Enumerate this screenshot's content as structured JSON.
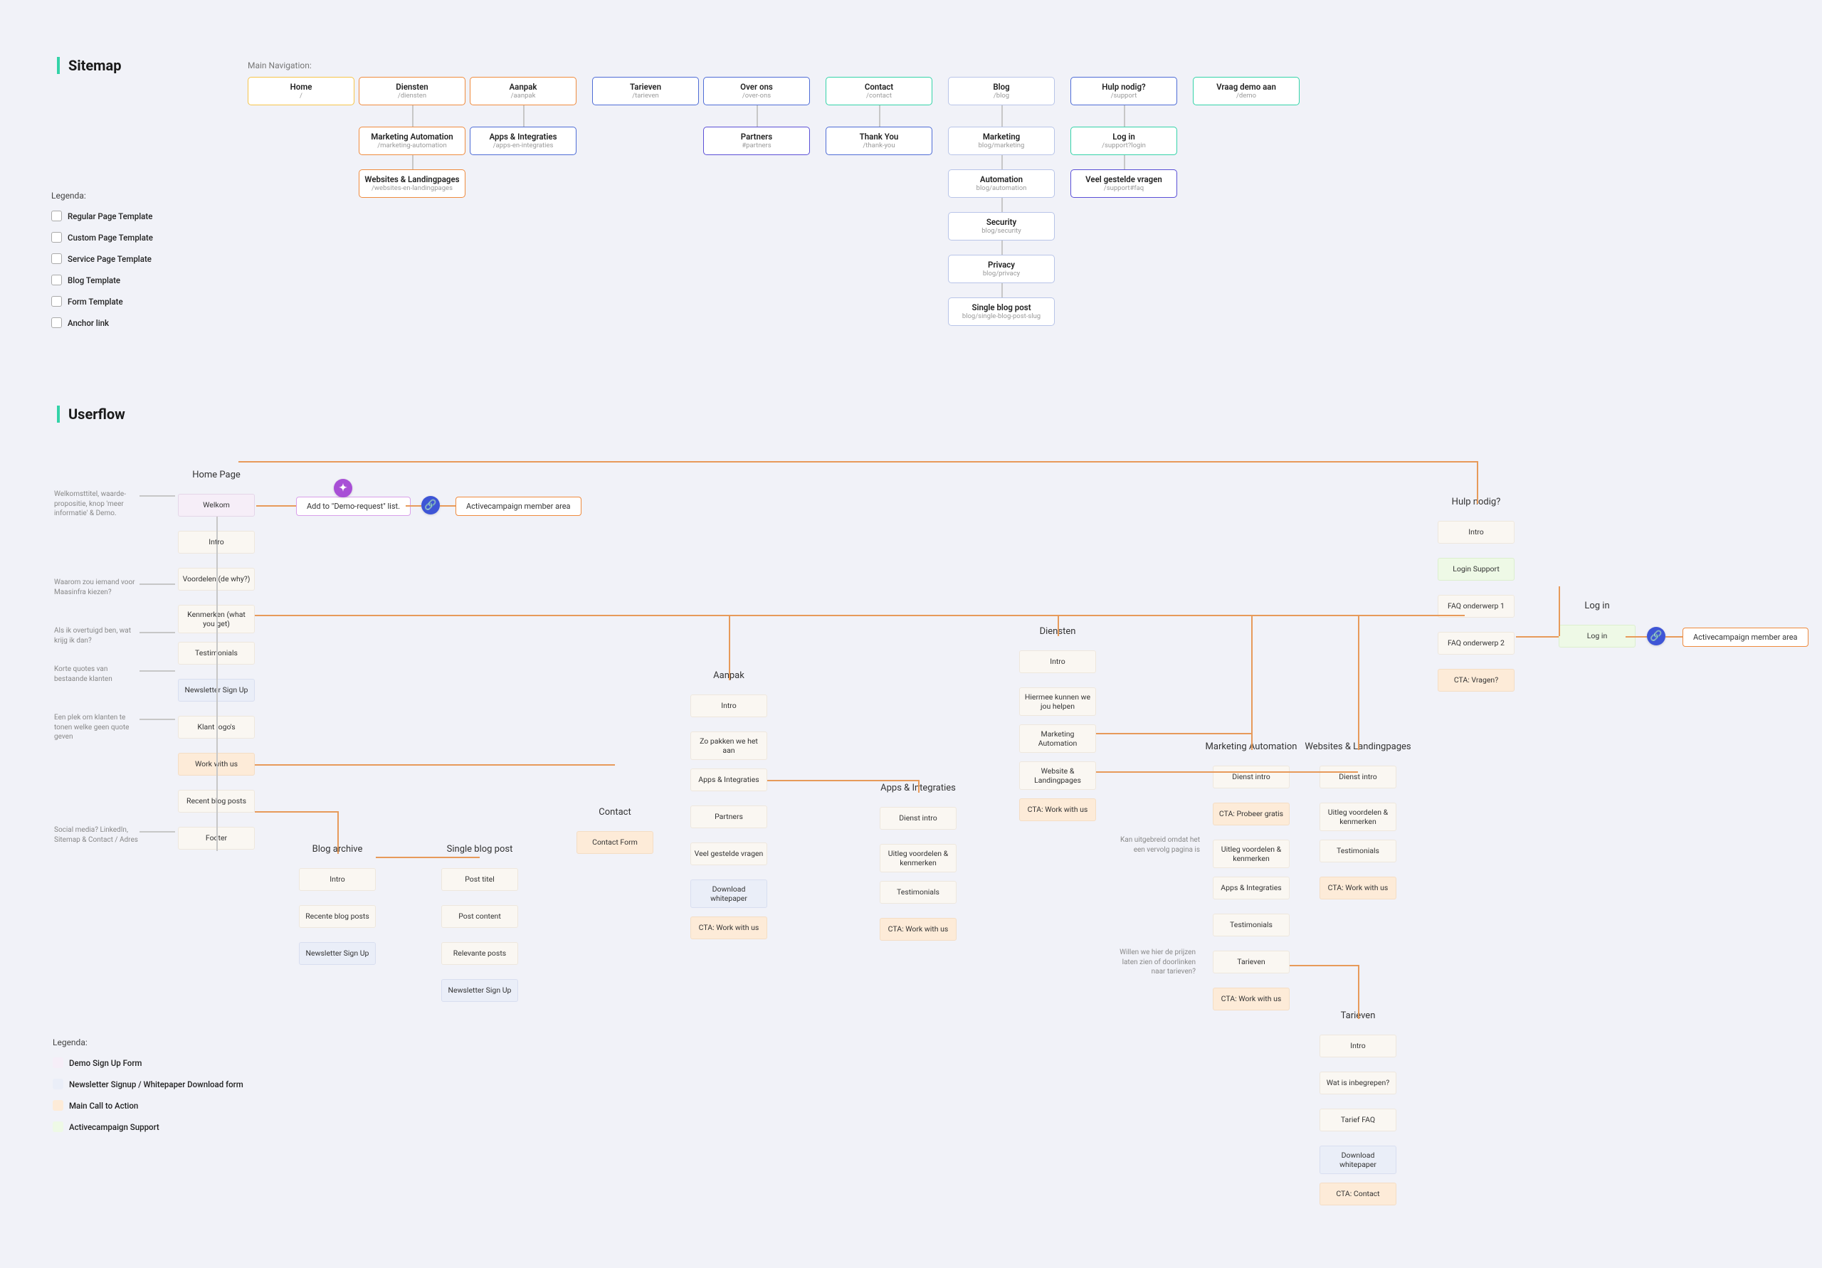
{
  "titles": {
    "sitemap": "Sitemap",
    "userflow": "Userflow"
  },
  "labels": {
    "main_nav": "Main Navigation:",
    "legend": "Legenda:"
  },
  "legend_sitemap": [
    "Regular Page Template",
    "Custom Page Template",
    "Service Page Template",
    "Blog Template",
    "Form Template",
    "Anchor link"
  ],
  "legend_userflow": [
    "Demo Sign Up Form",
    "Newsletter Signup / Whitepaper Download form",
    "Main Call to Action",
    "Activecampaign Support"
  ],
  "sitemap": {
    "row1": [
      {
        "t": "Home",
        "s": "/",
        "cls": "sm-custom"
      },
      {
        "t": "Diensten",
        "s": "/diensten",
        "cls": "sm-service"
      },
      {
        "t": "Aanpak",
        "s": "/aanpak",
        "cls": "sm-service"
      },
      {
        "t": "Tarieven",
        "s": "/tarieven",
        "cls": "sm-regular"
      },
      {
        "t": "Over ons",
        "s": "/over-ons",
        "cls": "sm-regular"
      },
      {
        "t": "Contact",
        "s": "/contact",
        "cls": "sm-form"
      },
      {
        "t": "Blog",
        "s": "/blog",
        "cls": "sm-blog"
      },
      {
        "t": "Hulp nodig?",
        "s": "/support",
        "cls": "sm-regular"
      },
      {
        "t": "Vraag demo aan",
        "s": "/demo",
        "cls": "sm-form"
      }
    ],
    "diensten_children": [
      {
        "t": "Marketing Automation",
        "s": "/marketing-automation",
        "cls": "sm-service"
      },
      {
        "t": "Websites & Landingpages",
        "s": "/websites-en-landingpages",
        "cls": "sm-service"
      }
    ],
    "aanpak_children": [
      {
        "t": "Apps & Integraties",
        "s": "/apps-en-integraties",
        "cls": "sm-regular"
      }
    ],
    "overons_children": [
      {
        "t": "Partners",
        "s": "#partners",
        "cls": "sm-anchor"
      }
    ],
    "contact_children": [
      {
        "t": "Thank You",
        "s": "/thank-you",
        "cls": "sm-regular"
      }
    ],
    "blog_children": [
      {
        "t": "Marketing",
        "s": "blog/marketing",
        "cls": "sm-blog"
      },
      {
        "t": "Automation",
        "s": "blog/automation",
        "cls": "sm-blog"
      },
      {
        "t": "Security",
        "s": "blog/security",
        "cls": "sm-blog"
      },
      {
        "t": "Privacy",
        "s": "blog/privacy",
        "cls": "sm-blog"
      },
      {
        "t": "Single blog post",
        "s": "blog/single-blog-post-slug",
        "cls": "sm-blog"
      }
    ],
    "support_children": [
      {
        "t": "Log in",
        "s": "/support?login",
        "cls": "sm-form"
      },
      {
        "t": "Veel gestelde vragen",
        "s": "/support#faq",
        "cls": "sm-anchor"
      }
    ]
  },
  "userflow": {
    "home_title": "Home Page",
    "home": [
      {
        "label": "Welkom",
        "cls": "uf-demo"
      },
      {
        "label": "Intro",
        "cls": "uf-plain"
      },
      {
        "label": "Voordelen (de why?)",
        "cls": "uf-plain"
      },
      {
        "label": "Kenmerken (what you get)",
        "cls": "uf-plain"
      },
      {
        "label": "Testimonials",
        "cls": "uf-plain"
      },
      {
        "label": "Newsletter Sign Up",
        "cls": "uf-nl"
      },
      {
        "label": "Klant logo's",
        "cls": "uf-plain"
      },
      {
        "label": "Work with us",
        "cls": "uf-cta"
      },
      {
        "label": "Recent blog posts",
        "cls": "uf-plain"
      },
      {
        "label": "Footer",
        "cls": "uf-plain"
      }
    ],
    "home_notes": [
      "Welkomsttitel, waarde-propositie, knop 'meer informatie' & Demo.",
      "Waarom zou iemand voor Maasinfra kiezen?",
      "Als ik overtuigd ben, wat krijg ik dan?",
      "Korte quotes van bestaande klanten",
      "Een plek om klanten te tonen welke geen quote geven",
      "Social media? LinkedIn, Sitemap & Contact / Adres"
    ],
    "flow_demo_request": "Add to \"Demo-request\" list.",
    "flow_ac_member": "Activecampaign member area",
    "blog_archive_title": "Blog archive",
    "blog_archive": [
      {
        "label": "Intro",
        "cls": "uf-plain"
      },
      {
        "label": "Recente blog posts",
        "cls": "uf-plain"
      },
      {
        "label": "Newsletter Sign Up",
        "cls": "uf-nl"
      }
    ],
    "single_post_title": "Single blog post",
    "single_post": [
      {
        "label": "Post titel",
        "cls": "uf-plain"
      },
      {
        "label": "Post content",
        "cls": "uf-plain"
      },
      {
        "label": "Relevante posts",
        "cls": "uf-plain"
      },
      {
        "label": "Newsletter Sign Up",
        "cls": "uf-nl"
      }
    ],
    "contact_title": "Contact",
    "contact": [
      {
        "label": "Contact Form",
        "cls": "uf-cta"
      }
    ],
    "aanpak_title": "Aanpak",
    "aanpak": [
      {
        "label": "Intro",
        "cls": "uf-plain"
      },
      {
        "label": "Zo pakken we het aan",
        "cls": "uf-plain"
      },
      {
        "label": "Apps & Integraties",
        "cls": "uf-plain"
      },
      {
        "label": "Partners",
        "cls": "uf-plain"
      },
      {
        "label": "Veel gestelde vragen",
        "cls": "uf-plain"
      },
      {
        "label": "Download whitepaper",
        "cls": "uf-nl"
      },
      {
        "label": "CTA: Work with us",
        "cls": "uf-cta"
      }
    ],
    "apps_title": "Apps & Integraties",
    "apps": [
      {
        "label": "Dienst intro",
        "cls": "uf-plain"
      },
      {
        "label": "Uitleg voordelen & kenmerken",
        "cls": "uf-plain"
      },
      {
        "label": "Testimonials",
        "cls": "uf-plain"
      },
      {
        "label": "CTA: Work with us",
        "cls": "uf-cta"
      }
    ],
    "diensten_title": "Diensten",
    "diensten": [
      {
        "label": "Intro",
        "cls": "uf-plain"
      },
      {
        "label": "Hiermee kunnen we jou helpen",
        "cls": "uf-plain"
      },
      {
        "label": "Marketing Automation",
        "cls": "uf-plain"
      },
      {
        "label": "Website & Landingpages",
        "cls": "uf-plain"
      },
      {
        "label": "CTA: Work with us",
        "cls": "uf-cta"
      }
    ],
    "ma_title": "Marketing Automation",
    "ma": [
      {
        "label": "Dienst intro",
        "cls": "uf-plain"
      },
      {
        "label": "CTA: Probeer gratis",
        "cls": "uf-cta"
      },
      {
        "label": "Uitleg voordelen & kenmerken",
        "cls": "uf-plain"
      },
      {
        "label": "Apps & Integraties",
        "cls": "uf-plain"
      },
      {
        "label": "Testimonials",
        "cls": "uf-plain"
      },
      {
        "label": "Tarieven",
        "cls": "uf-plain"
      },
      {
        "label": "CTA: Work with us",
        "cls": "uf-cta"
      }
    ],
    "ma_notes": [
      "Kan uitgebreid omdat het een vervolg pagina is",
      "Willen we hier de prijzen laten zien of doorlinken naar tarieven?"
    ],
    "wl_title": "Websites & Landingpages",
    "wl": [
      {
        "label": "Dienst intro",
        "cls": "uf-plain"
      },
      {
        "label": "Uitleg voordelen & kenmerken",
        "cls": "uf-plain"
      },
      {
        "label": "Testimonials",
        "cls": "uf-plain"
      },
      {
        "label": "CTA: Work with us",
        "cls": "uf-cta"
      }
    ],
    "tarieven_title": "Tarieven",
    "tarieven": [
      {
        "label": "Intro",
        "cls": "uf-plain"
      },
      {
        "label": "Wat is inbegrepen?",
        "cls": "uf-plain"
      },
      {
        "label": "Tarief FAQ",
        "cls": "uf-plain"
      },
      {
        "label": "Download whitepaper",
        "cls": "uf-nl"
      },
      {
        "label": "CTA: Contact",
        "cls": "uf-cta"
      }
    ],
    "hulp_title": "Hulp nodig?",
    "hulp": [
      {
        "label": "Intro",
        "cls": "uf-plain"
      },
      {
        "label": "Login Support",
        "cls": "uf-ac"
      },
      {
        "label": "FAQ onderwerp 1",
        "cls": "uf-plain"
      },
      {
        "label": "FAQ onderwerp 2",
        "cls": "uf-plain"
      },
      {
        "label": "CTA: Vragen?",
        "cls": "uf-cta"
      }
    ],
    "login_title": "Log in",
    "login": [
      {
        "label": "Log in",
        "cls": "uf-ac"
      }
    ]
  }
}
